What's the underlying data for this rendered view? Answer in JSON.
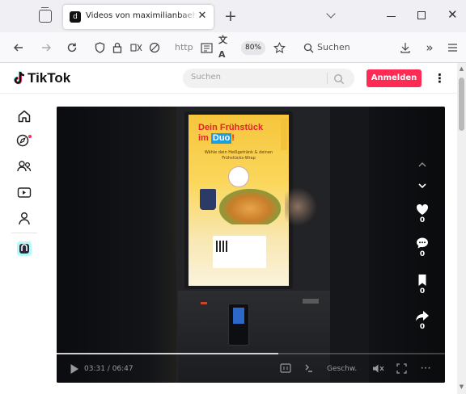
{
  "browser": {
    "tab_title": "Videos von maximilianbaehring",
    "tab_favicon": "d",
    "url_text": "http",
    "zoom_level": "80%",
    "search_placeholder": "Suchen"
  },
  "tiktok": {
    "logo_text": "TikTok",
    "search_placeholder": "Suchen",
    "login_label": "Anmelden",
    "more_label": "⋮"
  },
  "video": {
    "screen_headline_1": "Dein Frühstück",
    "screen_headline_2_prefix": "im",
    "screen_headline_2_brand": "Duo",
    "screen_headline_2_suffix": "!",
    "screen_subtext": "Wähle dein Heißgetränk & deinen Frühstücks-Wrap",
    "time_display": "03:31 / 06:47",
    "speed_label": "Geschw.",
    "progress_fraction": 0.57,
    "actions": [
      {
        "name": "like",
        "count": "0"
      },
      {
        "name": "comment",
        "count": "0"
      },
      {
        "name": "save",
        "count": "0"
      },
      {
        "name": "share",
        "count": "0"
      }
    ]
  }
}
